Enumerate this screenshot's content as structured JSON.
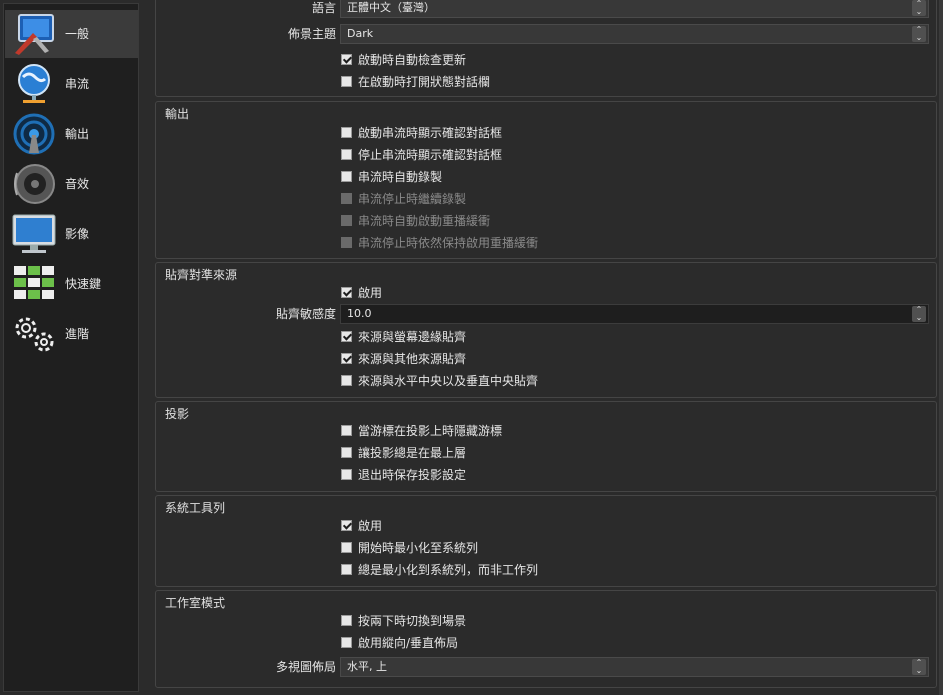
{
  "sidebar": {
    "items": [
      {
        "label": "一般",
        "icon": "general-icon"
      },
      {
        "label": "串流",
        "icon": "stream-icon"
      },
      {
        "label": "輸出",
        "icon": "output-icon"
      },
      {
        "label": "音效",
        "icon": "audio-icon"
      },
      {
        "label": "影像",
        "icon": "video-icon"
      },
      {
        "label": "快速鍵",
        "icon": "hotkeys-icon"
      },
      {
        "label": "進階",
        "icon": "advanced-icon"
      }
    ],
    "active_index": 0
  },
  "general": {
    "language_label": "語言",
    "language_value": "正體中文（臺灣）",
    "theme_label": "佈景主題",
    "theme_value": "Dark",
    "check_updates": {
      "label": "啟動時自動檢查更新",
      "checked": true
    },
    "open_stats": {
      "label": "在啟動時打開狀態對話欄",
      "checked": false
    }
  },
  "output": {
    "title": "輸出",
    "items": [
      {
        "label": "啟動串流時顯示確認對話框",
        "checked": false,
        "enabled": true
      },
      {
        "label": "停止串流時顯示確認對話框",
        "checked": false,
        "enabled": true
      },
      {
        "label": "串流時自動錄製",
        "checked": false,
        "enabled": true
      },
      {
        "label": "串流停止時繼續錄製",
        "checked": false,
        "enabled": false
      },
      {
        "label": "串流時自動啟動重播緩衝",
        "checked": false,
        "enabled": false
      },
      {
        "label": "串流停止時依然保持啟用重播緩衝",
        "checked": false,
        "enabled": false
      }
    ]
  },
  "snapping": {
    "title": "貼齊對準來源",
    "enable": {
      "label": "啟用",
      "checked": true
    },
    "sensitivity_label": "貼齊敏感度",
    "sensitivity_value": "10.0",
    "items": [
      {
        "label": "來源與螢幕邊緣貼齊",
        "checked": true
      },
      {
        "label": "來源與其他來源貼齊",
        "checked": true
      },
      {
        "label": "來源與水平中央以及垂直中央貼齊",
        "checked": false
      }
    ]
  },
  "projectors": {
    "title": "投影",
    "items": [
      {
        "label": "當游標在投影上時隱藏游標",
        "checked": false
      },
      {
        "label": "讓投影總是在最上層",
        "checked": false
      },
      {
        "label": "退出時保存投影設定",
        "checked": false
      }
    ]
  },
  "tray": {
    "title": "系統工具列",
    "items": [
      {
        "label": "啟用",
        "checked": true
      },
      {
        "label": "開始時最小化至系統列",
        "checked": false
      },
      {
        "label": "總是最小化到系統列，而非工作列",
        "checked": false
      }
    ]
  },
  "studio": {
    "title": "工作室模式",
    "items": [
      {
        "label": "按兩下時切換到場景",
        "checked": false
      },
      {
        "label": "啟用縱向/垂直佈局",
        "checked": false
      }
    ],
    "multiview_label": "多視圖佈局",
    "multiview_value": "水平, 上"
  },
  "colors": {
    "accent": "#1e1e1e",
    "panel": "#2b2b2b",
    "sidebar": "#1f1f1f"
  }
}
